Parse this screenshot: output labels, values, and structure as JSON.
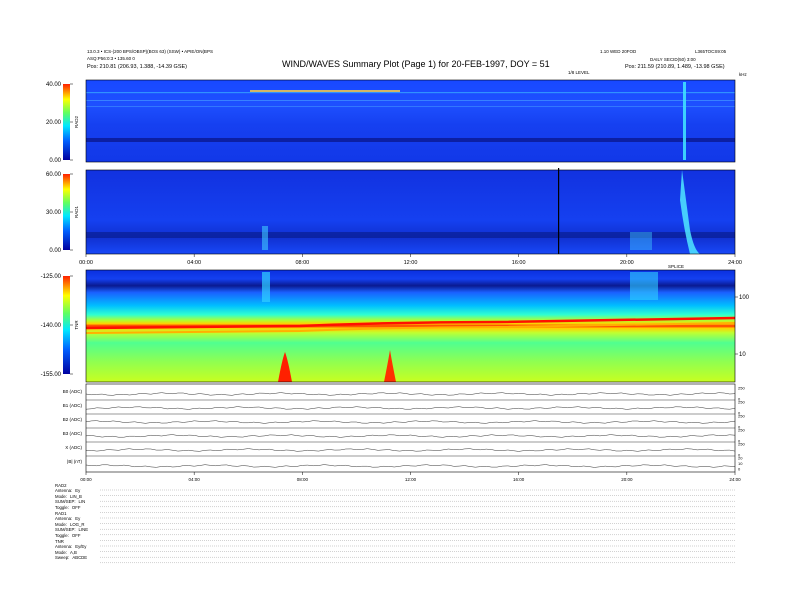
{
  "header": {
    "title": "WIND/WAVES Summary Plot (Page 1) for 20-FEB-1997, DOY = 51",
    "left_line1": "13.0.3 • ICS-(200 BPS/OBSP)(BOS 63) (SSW) • APIE/ON(BPS",
    "left_line2": "ASQ:P56:0:3 • 135.60 0",
    "left_pos": "Pos:    210.81 (206.93, 1.388, -14.39 GSE)",
    "right_line1": "1.10 WED 20FOD",
    "right_line2": "L365TOCS9:05",
    "right_line3": "DAILY SECID(50) 3:00",
    "right_pos": "Pos:    211.59 (210.89, 1.489, -13.98 GSE)",
    "top_mid_label": "1/8 LEVEL",
    "top_right_label": "kHz"
  },
  "chart_data": [
    {
      "type": "heatmap",
      "id": "rad2",
      "ylabel": "RAD2",
      "colorbar_ticks": [
        "40.00",
        "20.00",
        "0.00"
      ],
      "colorbar_range": [
        0,
        40
      ]
    },
    {
      "type": "heatmap",
      "id": "rad1",
      "ylabel": "RAD1",
      "colorbar_ticks": [
        "60.00",
        "30.00",
        "0.00"
      ],
      "colorbar_range": [
        0,
        60
      ],
      "x_ticks": [
        "00:00",
        "04:00",
        "08:00",
        "12:00",
        "16:00",
        "20:00",
        "24:00"
      ],
      "x_range_hours": [
        0,
        24
      ]
    },
    {
      "type": "heatmap",
      "id": "tnr",
      "ylabel": "TNR",
      "colorbar_ticks": [
        "-125.00",
        "-140.00",
        "-155.00"
      ],
      "colorbar_range": [
        -155,
        -125
      ],
      "right_ticks": [
        "100",
        "10"
      ],
      "top_right_label": "SPLICE"
    },
    {
      "type": "line",
      "id": "sensors",
      "series": [
        {
          "name": "B0 (ADC)",
          "right_ticks": [
            "250",
            "0"
          ]
        },
        {
          "name": "B1 (ADC)",
          "right_ticks": [
            "250",
            "0"
          ]
        },
        {
          "name": "B2 (ADC)",
          "right_ticks": [
            "250",
            "0"
          ]
        },
        {
          "name": "B3 (ADC)",
          "right_ticks": [
            "250",
            "0"
          ]
        },
        {
          "name": "X (ADC)",
          "right_ticks": [
            "250",
            "0"
          ]
        },
        {
          "name": "|B| (nT)",
          "right_ticks": [
            "20",
            "10",
            "0"
          ]
        }
      ],
      "x_ticks": [
        "00:00",
        "04:00",
        "08:00",
        "12:00",
        "16:00",
        "20:00",
        "24:00"
      ]
    }
  ],
  "modes": [
    {
      "k": "RAD2",
      "v": ""
    },
    {
      "k": "Antenna:",
      "v": "Ey"
    },
    {
      "k": "Mode:",
      "v": "LIN_B"
    },
    {
      "k": "SUM/SEP:",
      "v": "LIN"
    },
    {
      "k": "Toggle:",
      "v": "OFF"
    },
    {
      "k": "RAD1",
      "v": ""
    },
    {
      "k": "Antenna:",
      "v": "Ey"
    },
    {
      "k": "Mode:",
      "v": "LOG_R"
    },
    {
      "k": "SUM/SEP:",
      "v": "LINE"
    },
    {
      "k": "Toggle:",
      "v": "OFF"
    },
    {
      "k": "TNR",
      "v": ""
    },
    {
      "k": "Antenna:",
      "v": "Ey/Ey"
    },
    {
      "k": "Mode:",
      "v": "A,B"
    },
    {
      "k": "Sweep:",
      "v": "ABCDE"
    }
  ],
  "colors": {
    "navy": "#00008f",
    "blue": "#1c3cff",
    "cyan": "#00e0ff",
    "green": "#70ff60",
    "yellow": "#ffff00",
    "red": "#ff0000"
  }
}
